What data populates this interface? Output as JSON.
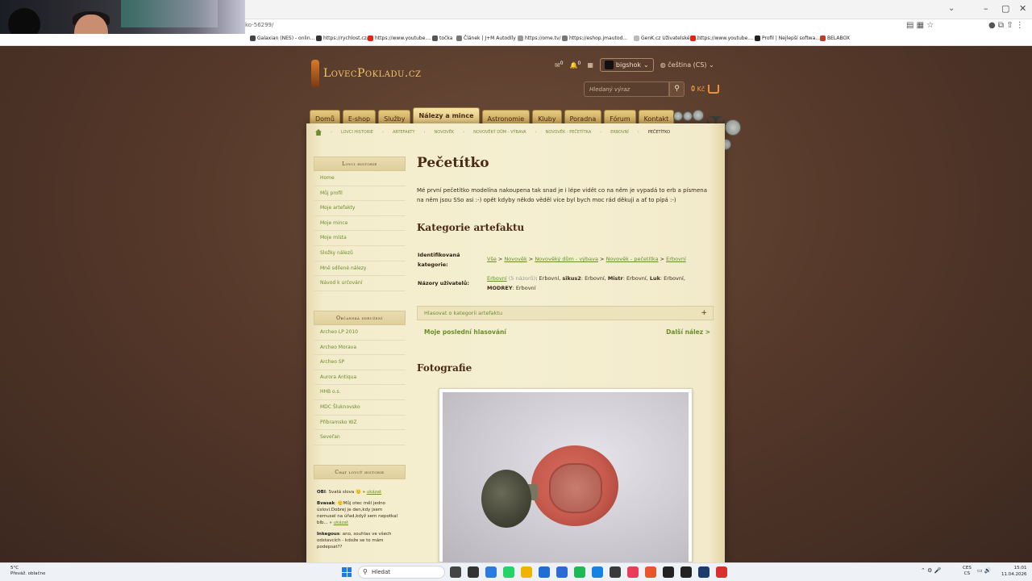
{
  "browser": {
    "url_fragment": "ko-56299/",
    "bookmarks": [
      {
        "label": "Galaxian (NES) - onlin...",
        "color": "#444"
      },
      {
        "label": "https://rychlost.cz/",
        "color": "#333"
      },
      {
        "label": "https://www.youtube....",
        "color": "#e62117"
      },
      {
        "label": "točka",
        "color": "#555"
      },
      {
        "label": "Článek | J+M Autodíly",
        "color": "#777"
      },
      {
        "label": "https://ome.tv/",
        "color": "#999"
      },
      {
        "label": "https://eshop.jmautod...",
        "color": "#777"
      },
      {
        "label": "GenK.cz Uživatelské ro...",
        "color": "#bbb"
      },
      {
        "label": "https://www.youtube....",
        "color": "#e62117"
      },
      {
        "label": "Profil | Nejlepší softwa...",
        "color": "#222"
      },
      {
        "label": "BELABOX",
        "color": "#c0392b"
      }
    ]
  },
  "header": {
    "logo_text": "LovecPokladu.cz",
    "mail_count": "0",
    "notif_count": "0",
    "username": "bigshok",
    "language": "čeština (CS)",
    "search_placeholder": "Hledaný výraz",
    "cart_amount": "0 Kč",
    "cart_count": "0"
  },
  "nav": {
    "items": [
      "Domů",
      "E-shop",
      "Služby",
      "Nálezy a mince",
      "Astronomie",
      "Kluby",
      "Poradna",
      "Fórum",
      "Kontakt"
    ],
    "active": "Nálezy a mince"
  },
  "breadcrumb": {
    "items": [
      "Lovci historie",
      "Artefakty",
      "Novověk",
      "Novověký dům - výbava",
      "Novověk - pečetítka",
      "Erbovní"
    ],
    "current": "Pečetítko"
  },
  "sidebar": {
    "section1_title": "Lovci historie",
    "section1_items": [
      "Home",
      "Můj profil",
      "Moje artefakty",
      "Moje mince",
      "Moje místa",
      "Složky nálezů",
      "Mně sdílené nálezy",
      "Návod k určování"
    ],
    "section2_title": "Občanská sdružení",
    "section2_items": [
      "Archeo LP 2010",
      "Archeo Morava",
      "Archeo SP",
      "Aurora Antiqua",
      "HHB o.s.",
      "MDC Šluknovsko",
      "Příbramsko WZ",
      "Seveřan"
    ],
    "chat_title": "Chat lovců historie",
    "chat": [
      {
        "user": "OBI",
        "text": ": Svatá slova 🙂 »",
        "link": "ukázat"
      },
      {
        "user": "Bvasak",
        "text": ": 🙂Můj otec měl jedno úslovi.Dobrej je den,kdy jsem nemusel na úřad,když sem nepotkal blb... »",
        "link": "ukázat"
      },
      {
        "user": "Inkegous",
        "text": ": ano, souhlas ve všech odstavcích - kdože se to mám podepsat??",
        "link": ""
      }
    ]
  },
  "main": {
    "title": "Pečetítko",
    "description": "Mé první pečetítko modelína nakoupena tak snad je i lépe vidět co na něm je vypadá to erb a písmena na něm jsou SSo asi :-) opět kdyby někdo věděl více byl bych moc rád děkuji a ať to pípá :-)",
    "category_heading": "Kategorie artefaktu",
    "identified_label": "Identifikovaná kategorie:",
    "identified_path": [
      "Vše",
      "Novověk",
      "Novověký dům - výbava",
      "Novověk - pečetítka",
      "Erbovní"
    ],
    "opinions_label": "Názory uživatelů:",
    "opinions_link": "Erbovní",
    "opinions_count": "(5 názorů)",
    "opinions_rest_1": ": Erbovní, ",
    "opinion_users": [
      {
        "user": "sikus2",
        "value": "Erbovní"
      },
      {
        "user": "Mistr",
        "value": "Erbovní"
      },
      {
        "user": "Luk",
        "value": "Erbovní"
      },
      {
        "user": "MODREY",
        "value": "Erbovní"
      }
    ],
    "vote_bar_label": "Hlasovat o kategorii artefaktu",
    "vote_plus": "+",
    "my_votes_link": "Moje poslední hlasování",
    "next_find_link": "Další nález >",
    "photos_heading": "Fotografie"
  },
  "taskbar": {
    "temp": "5°C",
    "weather": "Převáž. oblačno",
    "search_label": "Hledat",
    "lang_top": "CES",
    "lang_bottom": "CS",
    "time": "15:01",
    "date": "11.04.2026",
    "app_colors": [
      "#444",
      "#333",
      "#2a7be0",
      "#25d366",
      "#f0b400",
      "#1f6fd0",
      "#2c6ad8",
      "#1db954",
      "#1683e0",
      "#3a3a3a",
      "#ea3d5a",
      "#e8542c",
      "#222",
      "#222",
      "#1a3b6b",
      "#d8302c"
    ]
  }
}
